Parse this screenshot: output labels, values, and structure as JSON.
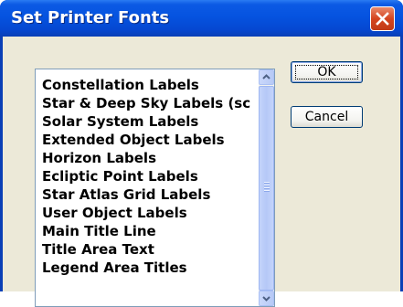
{
  "window": {
    "title": "Set Printer Fonts"
  },
  "list": {
    "items": [
      "Constellation Labels",
      "Star & Deep Sky Labels (sc",
      "Solar System Labels",
      "Extended Object Labels",
      "Horizon Labels",
      "Ecliptic Point Labels",
      "Star Atlas Grid Labels",
      "User Object Labels",
      "Main Title Line",
      "Title Area Text",
      "Legend Area Titles"
    ]
  },
  "buttons": {
    "ok": "OK",
    "cancel": "Cancel"
  },
  "colors": {
    "titlebar": "#0553e0",
    "client": "#ece9d8",
    "close": "#d4441f"
  },
  "icons": [
    "close-icon",
    "scroll-up-icon",
    "scroll-down-icon"
  ]
}
